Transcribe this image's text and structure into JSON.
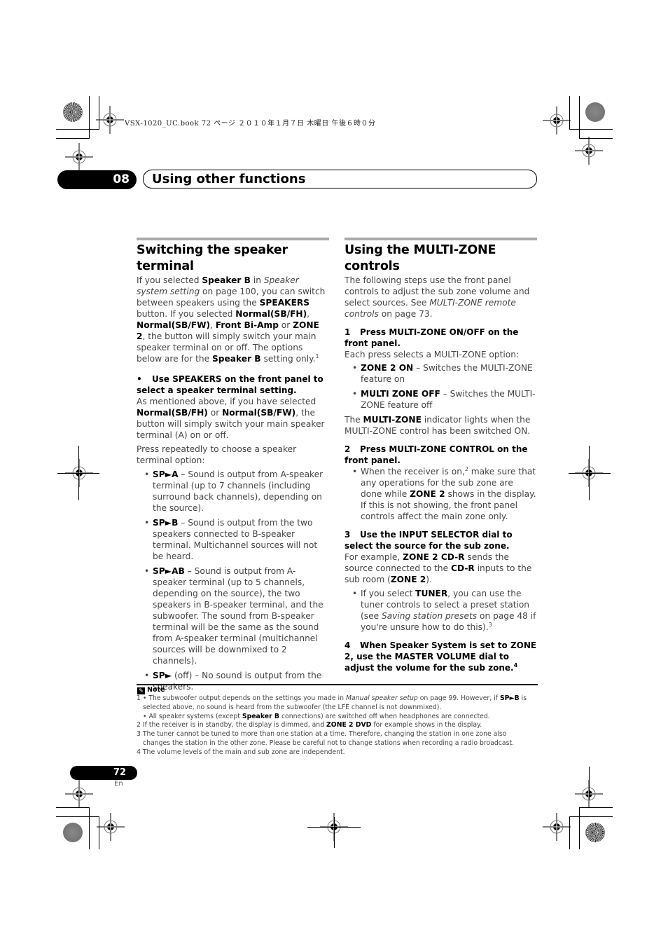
{
  "slug": "VSX-1020_UC.book   72 ページ   ２０１０年１月７日   木曜日   午後６時０分",
  "chapter": {
    "number": "08",
    "title": "Using other functions"
  },
  "left": {
    "title": "Switching the speaker terminal",
    "intro": {
      "t1": "If you selected ",
      "b1": "Speaker B",
      "t2": " in ",
      "i1": "Speaker system setting",
      "t3": " on page 100, you can switch between speakers using the ",
      "b2": "SPEAKERS",
      "t4": " button. If you selected ",
      "b3": "Normal(SB/FH)",
      "t5": ", ",
      "b4": "Normal(SB/FW)",
      "t6": ", ",
      "b5": "Front Bi-Amp",
      "t7": " or ",
      "b6": "ZONE 2",
      "t8": ", the button will simply switch your main speaker terminal on or off. The options below are for the ",
      "b7": "Speaker B",
      "t9": " setting only.",
      "sup": "1"
    },
    "step_bullet": "•",
    "step_text": "Use SPEAKERS on the front panel to select a speaker terminal setting.",
    "mention": {
      "t1": "As mentioned above, if you have selected ",
      "b1": "Normal(SB/FH)",
      "t2": " or ",
      "b2": "Normal(SB/FW)",
      "t3": ", the button will simply switch your main speaker terminal (A) on or off."
    },
    "press": "Press repeatedly to choose a speaker terminal option:",
    "options": [
      {
        "label": "SP►A",
        "text": " – Sound is output from A-speaker terminal (up to 7 channels (including surround back channels), depending on the source)."
      },
      {
        "label": "SP►B",
        "text": " – Sound is output from the two speakers connected to B-speaker terminal. Multichannel sources will not be heard."
      },
      {
        "label": "SP►AB",
        "text": " – Sound is output from A-speaker terminal (up to 5 channels, depending on the source), the two speakers in B-speaker terminal, and the subwoofer. The sound from B-speaker terminal will be the same as the sound from A-speaker terminal (multichannel sources will be downmixed to 2 channels)."
      },
      {
        "label": "SP►",
        "text": " (off) – No sound is output from the speakers."
      }
    ]
  },
  "right": {
    "title": "Using the MULTI-ZONE controls",
    "intro": {
      "t1": "The following steps use the front panel controls to adjust the sub zone volume and select sources. See ",
      "i1": "MULTI-ZONE remote controls",
      "t2": " on page 73."
    },
    "step1": {
      "num": "1",
      "text": "Press MULTI-ZONE ON/OFF on the front panel."
    },
    "step1_desc": "Each press selects a MULTI-ZONE option:",
    "step1_options": [
      {
        "label": "ZONE 2 ON",
        "text": " – Switches the MULTI-ZONE feature on"
      },
      {
        "label": "MULTI ZONE OFF",
        "text": " – Switches the MULTI-ZONE feature off"
      }
    ],
    "indicator": {
      "t1": "The ",
      "b1": "MULTI-ZONE",
      "t2": " indicator lights when the MULTI-ZONE control has been switched ON."
    },
    "step2": {
      "num": "2",
      "text": "Press MULTI-ZONE CONTROL on the front panel."
    },
    "step2_bullet": {
      "t1": "When the receiver is on,",
      "sup": "2",
      "t2": " make sure that any operations for the sub zone are done while ",
      "b1": "ZONE 2",
      "t3": " shows in the display. If this is not showing, the front panel controls affect the main zone only."
    },
    "step3": {
      "num": "3",
      "text": "Use the INPUT SELECTOR dial to select the source for the sub zone."
    },
    "step3_desc": {
      "t1": "For example, ",
      "b1": "ZONE 2 CD-R",
      "t2": " sends the source connected to the ",
      "b2": "CD-R",
      "t3": " inputs to the sub room (",
      "b3": "ZONE 2",
      "t4": ")."
    },
    "step3_bullet": {
      "t1": "If you select ",
      "b1": "TUNER",
      "t2": ", you can use the tuner controls to select a preset station (see ",
      "i1": "Saving station presets",
      "t3": " on page 48 if you're unsure how to do this).",
      "sup": "3"
    },
    "step4": {
      "num": "4",
      "text": "When Speaker System is set to ZONE 2, use the MASTER VOLUME dial to adjust the volume for the sub zone.",
      "sup": "4"
    }
  },
  "notes": {
    "heading": "Note",
    "n1a": {
      "t1": "1 • The subwoofer output depends on the settings you made in ",
      "i1": "Manual speaker setup",
      "t2": " on page 99. However, if ",
      "b1": "SP►B",
      "t3": " is"
    },
    "n1a_cont": "selected above, no sound is heard from the subwoofer (the LFE channel is not downmixed).",
    "n1b": {
      "t1": "• All speaker systems (except ",
      "b1": "Speaker B",
      "t2": " connections) are switched off when headphones are connected."
    },
    "n2": {
      "t1": "2 If the receiver is in standby, the display is dimmed, and ",
      "b1": "ZONE 2 DVD",
      "t2": " for example shows in the display."
    },
    "n3": "3 The tuner cannot be tuned to more than one station at a time. Therefore, changing the station in one zone also",
    "n3_cont": "changes the station in the other zone. Please be careful not to change stations when recording a radio broadcast.",
    "n4": "4 The volume levels of the main and sub zone are independent."
  },
  "footer": {
    "page": "72",
    "lang": "En"
  }
}
